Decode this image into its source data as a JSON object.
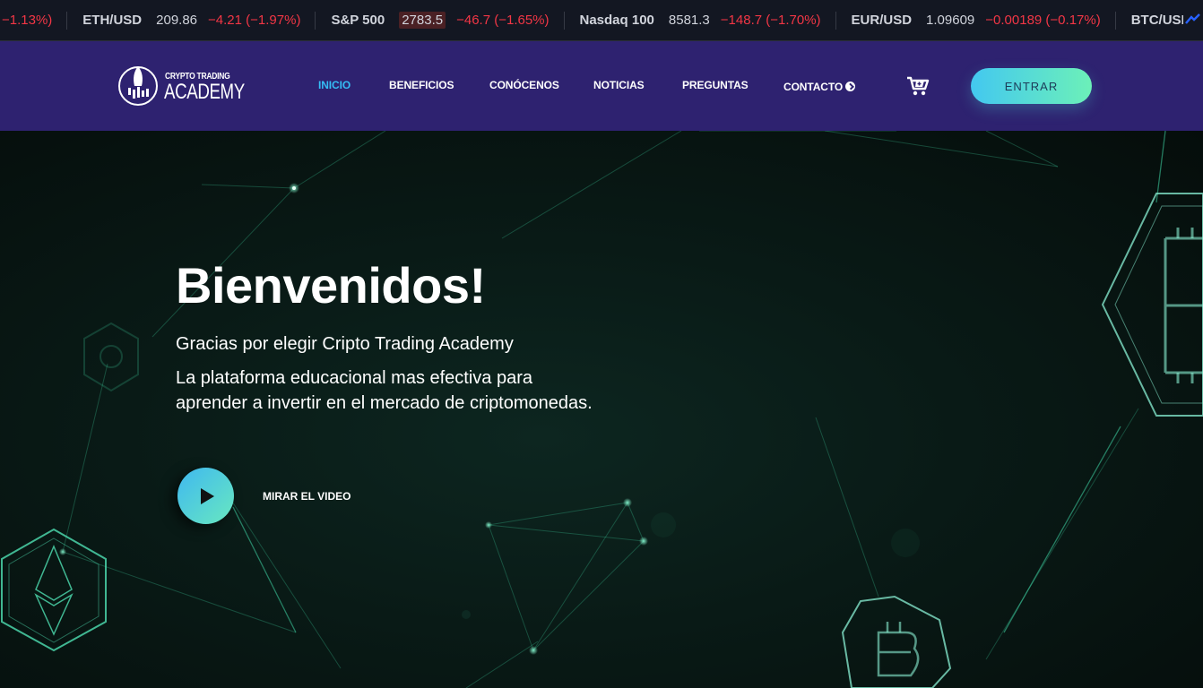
{
  "ticker": {
    "items": [
      {
        "symbol": "",
        "price": "",
        "change": "−1.13%)"
      },
      {
        "symbol": "ETH/USD",
        "price": "209.86",
        "change": "−4.21 (−1.97%)"
      },
      {
        "symbol": "S&P 500",
        "price": "2783.5",
        "change": "−46.7 (−1.65%)"
      },
      {
        "symbol": "Nasdaq 100",
        "price": "8581.3",
        "change": "−148.7 (−1.70%)"
      },
      {
        "symbol": "EUR/USD",
        "price": "1.09609",
        "change": "−0.00189 (−0.17%)"
      },
      {
        "symbol": "BTC/USD",
        "price": "",
        "change": ""
      }
    ]
  },
  "header": {
    "logo": {
      "line1": "CRYPTO TRADING",
      "line2": "ACADEMY"
    },
    "nav": [
      "INICIO",
      "BENEFICIOS",
      "CONÓCENOS",
      "NOTICIAS",
      "PREGUNTAS",
      "CONTACTO"
    ],
    "active_nav": "INICIO",
    "enter_label": "ENTRAR"
  },
  "hero": {
    "title": "Bienvenidos!",
    "subtitle": "Gracias por elegir Cripto Trading Academy",
    "description": "La plataforma educacional mas efectiva para aprender a invertir en el mercado de criptomonedas.",
    "video_label": "MIRAR EL VIDEO"
  },
  "colors": {
    "header_bg": "#2e2270",
    "nav_active": "#35bdf5",
    "ticker_negative": "#f23645",
    "accent_gradient_start": "#43c8f0",
    "accent_gradient_end": "#6cf0b8",
    "network_line": "#3fd6a6"
  },
  "icons": {
    "cart": "cart-plus-icon",
    "contact": "send-circle-icon",
    "play": "play-icon",
    "ticker_brand": "tradingview-icon",
    "logo": "rocket-icon"
  }
}
